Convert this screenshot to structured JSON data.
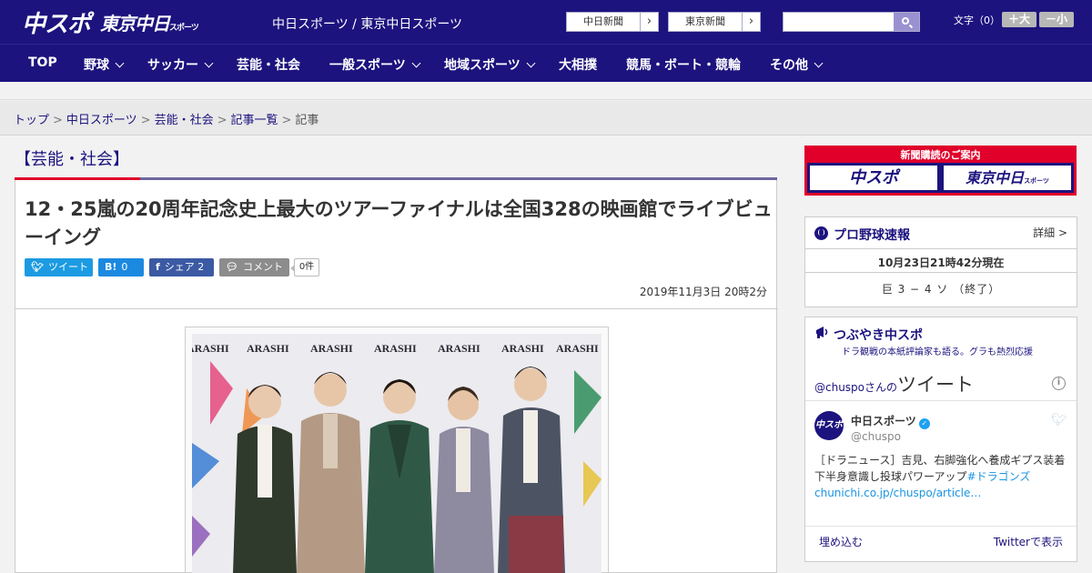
{
  "header": {
    "logo_main": "中スポ",
    "logo_tokyo": "東京中日",
    "logo_tokyo_suffix": "スポーツ",
    "site_names": "中日スポーツ / 東京中日スポーツ",
    "chunichi_label": "中日新聞",
    "tokyo_label": "東京新聞",
    "search": {
      "value": "",
      "placeholder": ""
    },
    "fontsize_label": "文字（0）",
    "font_larger": "＋大",
    "font_smaller": "－小"
  },
  "nav": {
    "items": [
      {
        "label": "TOP"
      },
      {
        "label": "野球"
      },
      {
        "label": "サッカー"
      },
      {
        "label": "芸能・社会"
      },
      {
        "label": "一般スポーツ"
      },
      {
        "label": "地域スポーツ"
      },
      {
        "label": "大相撲"
      },
      {
        "label": "競馬・ボート・競輪"
      },
      {
        "label": "その他"
      }
    ]
  },
  "breadcrumb": {
    "items": [
      "トップ",
      "中日スポーツ",
      "芸能・社会",
      "記事一覧"
    ],
    "current": "記事",
    "separator": ">"
  },
  "article": {
    "section": "【芸能・社会】",
    "headline": "12・25嵐の20周年記念史上最大のツアーファイナルは全国328の映画館でライブビューイング",
    "share": {
      "tweet": "ツイート",
      "hatena_icon": "B!",
      "hatena_count": "0",
      "facebook_label": "シェア",
      "facebook_count": "2",
      "comment_label": "コメント",
      "comment_count": "0件"
    },
    "date": "2019年11月3日 20時2分",
    "photo_banner_text": "ARASHI"
  },
  "sidebar": {
    "promo": {
      "heading": "新聞購読のご案内",
      "card1": "中スポ",
      "card2": "東京中日",
      "card2_suffix": "スポーツ"
    },
    "baseball": {
      "title": "プロ野球速報",
      "detail_link": "詳細 >",
      "updated": "10月23日21時42分現在",
      "score": "巨 3 − 4 ソ （終了）"
    },
    "twitter": {
      "title": "つぶやき中スポ",
      "subtitle": "ドラ観戦の本紙評論家も語る。グラも熱烈応援",
      "account_link": "@chuspo",
      "account_suffix": "さんの",
      "tweet_word": "ツイート",
      "info_icon": "i",
      "avatar_text": "中スポ",
      "account_name": "中日スポーツ",
      "handle": "@chuspo",
      "tweet_text": "［ドラニュース］吉見、右脚強化へ養成ギプス装着　下半身意識し投球パワーアップ",
      "tweet_hashtag": "#ドラゴンズ",
      "tweet_link": "chunichi.co.jp/chuspo/article…",
      "embed": "埋め込む",
      "view_on_twitter": "Twitterで表示"
    }
  },
  "colors": {
    "brand_navy": "#1c137e",
    "accent_red": "#e0002a",
    "twitter_blue": "#1c9be2",
    "facebook_blue": "#3b5aa3"
  }
}
